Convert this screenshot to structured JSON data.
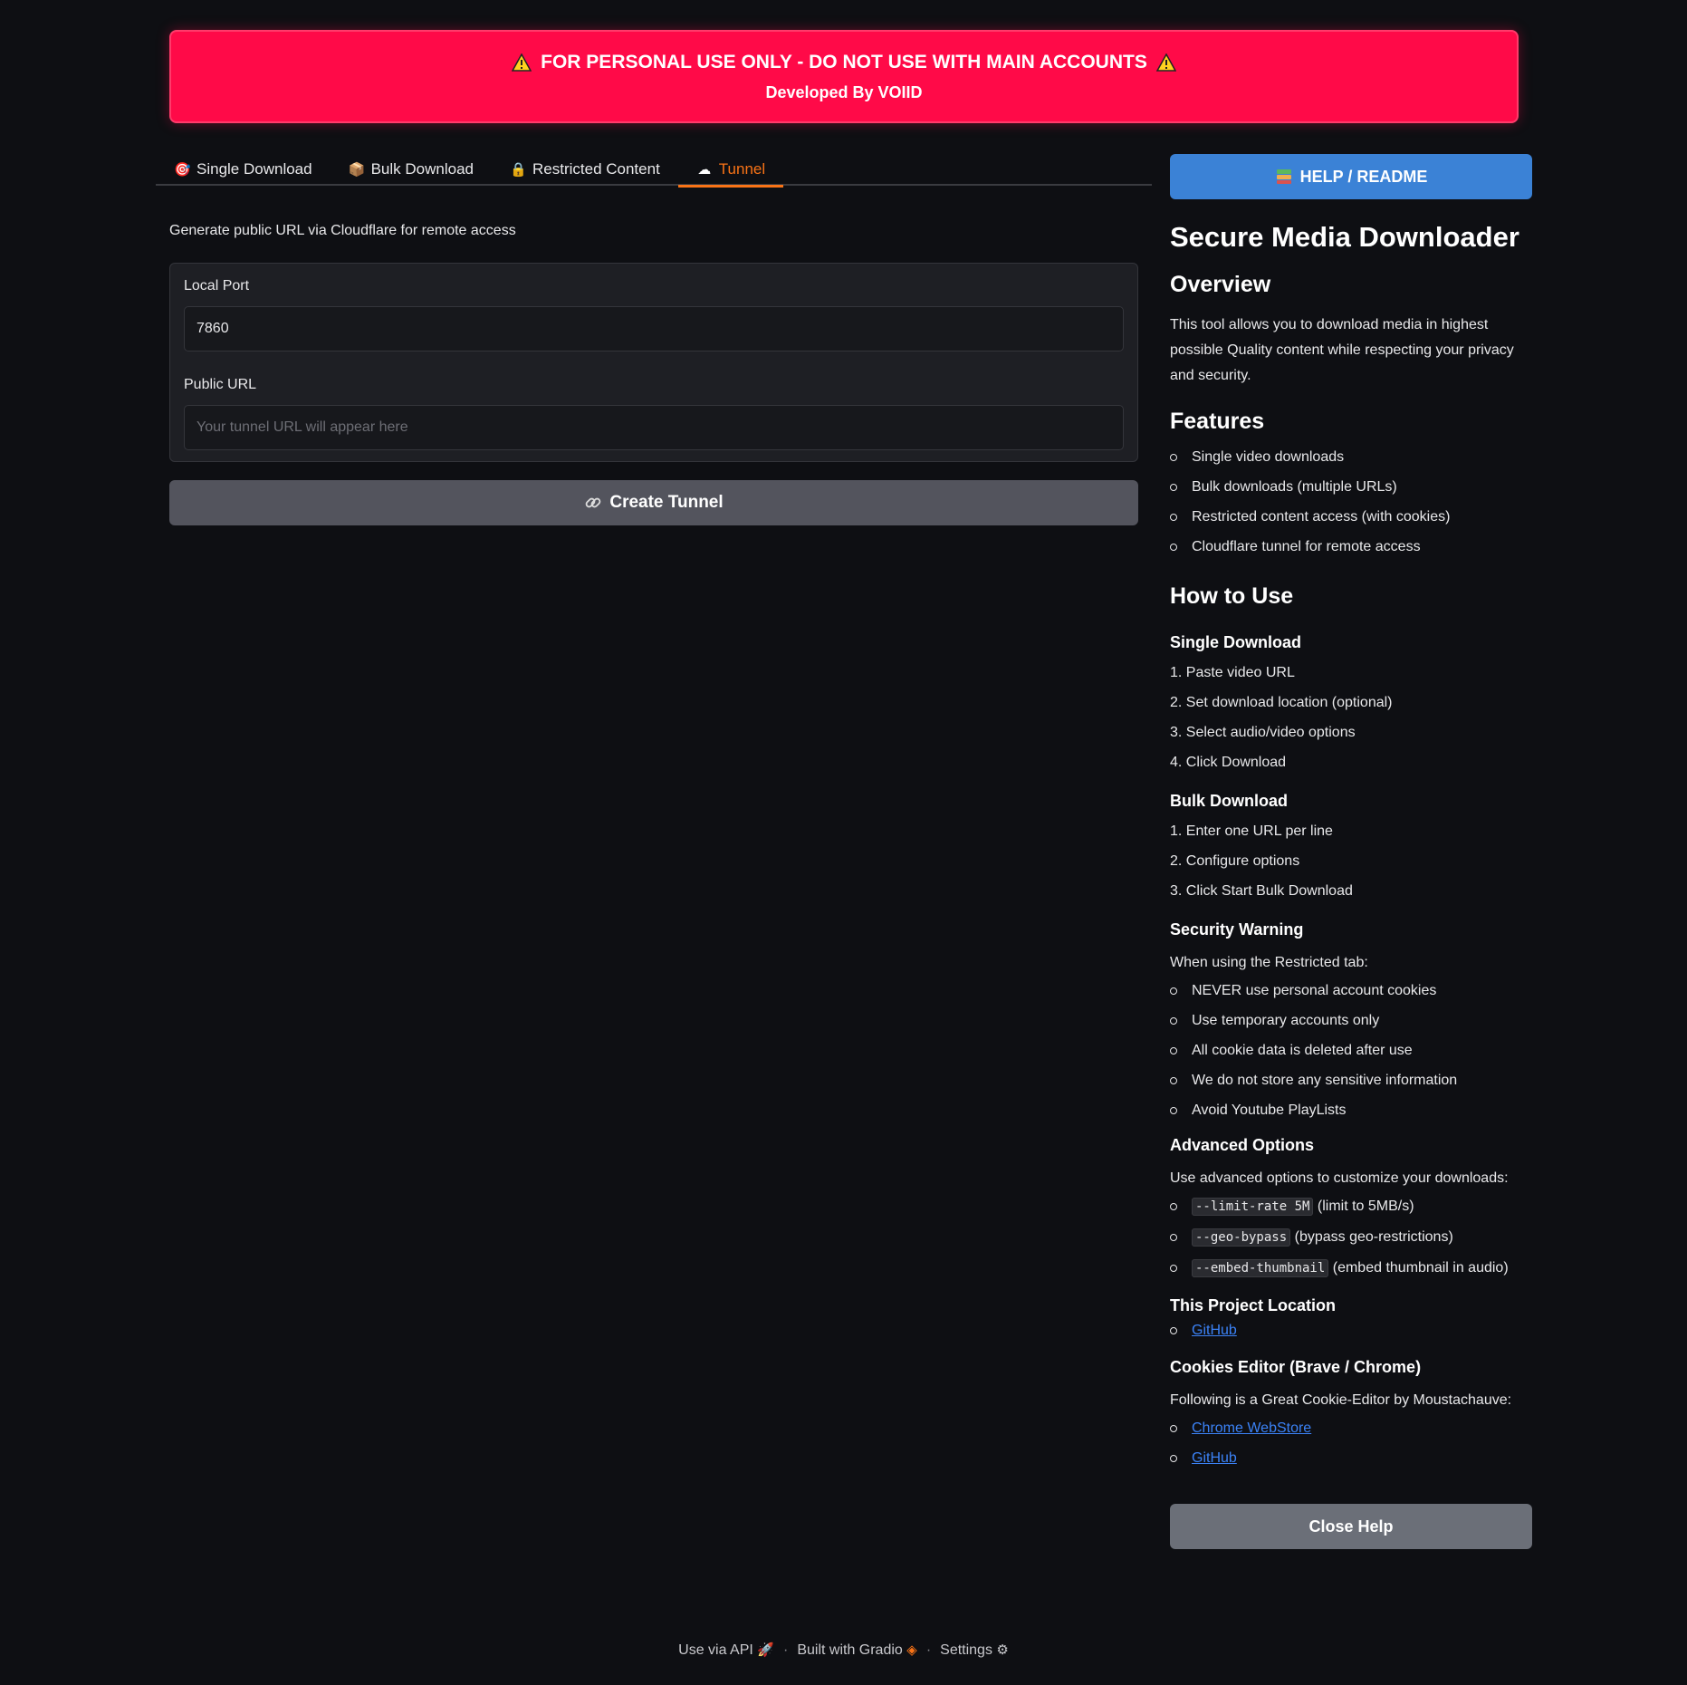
{
  "banner": {
    "title": "FOR PERSONAL USE ONLY - DO NOT USE WITH MAIN ACCOUNTS",
    "subtitle": "Developed By VOIID"
  },
  "tabs": [
    {
      "label": "Single Download",
      "icon": "target-icon",
      "glyph": "🎯",
      "active": false
    },
    {
      "label": "Bulk Download",
      "icon": "package-icon",
      "glyph": "📦",
      "active": false
    },
    {
      "label": "Restricted Content",
      "icon": "lock-icon",
      "glyph": "🔒",
      "active": false
    },
    {
      "label": "Tunnel",
      "icon": "cloud-icon",
      "glyph": "☁",
      "active": true
    }
  ],
  "tunnel": {
    "description": "Generate public URL via Cloudflare for remote access",
    "local_port_label": "Local Port",
    "local_port_value": "7860",
    "public_url_label": "Public URL",
    "public_url_placeholder": "Your tunnel URL will appear here",
    "create_button": "Create Tunnel"
  },
  "help": {
    "button": "HELP / README",
    "title": "Secure Media Downloader",
    "overview_heading": "Overview",
    "overview_text": "This tool allows you to download media in highest possible Quality content while respecting your privacy and security.",
    "features_heading": "Features",
    "features": [
      "Single video downloads",
      "Bulk downloads (multiple URLs)",
      "Restricted content access (with cookies)",
      "Cloudflare tunnel for remote access"
    ],
    "howto_heading": "How to Use",
    "single_heading": "Single Download",
    "single_steps": [
      "1. Paste video URL",
      "2. Set download location (optional)",
      "3. Select audio/video options",
      "4. Click Download"
    ],
    "bulk_heading": "Bulk Download",
    "bulk_steps": [
      "1. Enter one URL per line",
      "2. Configure options",
      "3. Click Start Bulk Download"
    ],
    "security_heading": "Security Warning",
    "security_intro": "When using the Restricted tab:",
    "security_items": [
      "NEVER use personal account cookies",
      "Use temporary accounts only",
      "All cookie data is deleted after use",
      "We do not store any sensitive information",
      "Avoid Youtube PlayLists"
    ],
    "advanced_heading": "Advanced Options",
    "advanced_intro": "Use advanced options to customize your downloads:",
    "advanced_items": [
      {
        "code": "--limit-rate 5M",
        "text": "(limit to 5MB/s)"
      },
      {
        "code": "--geo-bypass",
        "text": "(bypass geo-restrictions)"
      },
      {
        "code": "--embed-thumbnail",
        "text": "(embed thumbnail in audio)"
      }
    ],
    "project_heading": "This Project Location",
    "project_link": "GitHub",
    "cookies_heading": "Cookies Editor (Brave / Chrome)",
    "cookies_intro": "Following is a Great Cookie-Editor by Moustachauve:",
    "cookies_links": [
      "Chrome WebStore",
      "GitHub"
    ],
    "close_button": "Close Help"
  },
  "footer": {
    "api": "Use via API",
    "built": "Built with Gradio",
    "settings": "Settings"
  },
  "colors": {
    "banner": "#ff0a48",
    "accent": "#f97316",
    "help_button": "#3b82d6",
    "link": "#3b82f6"
  }
}
